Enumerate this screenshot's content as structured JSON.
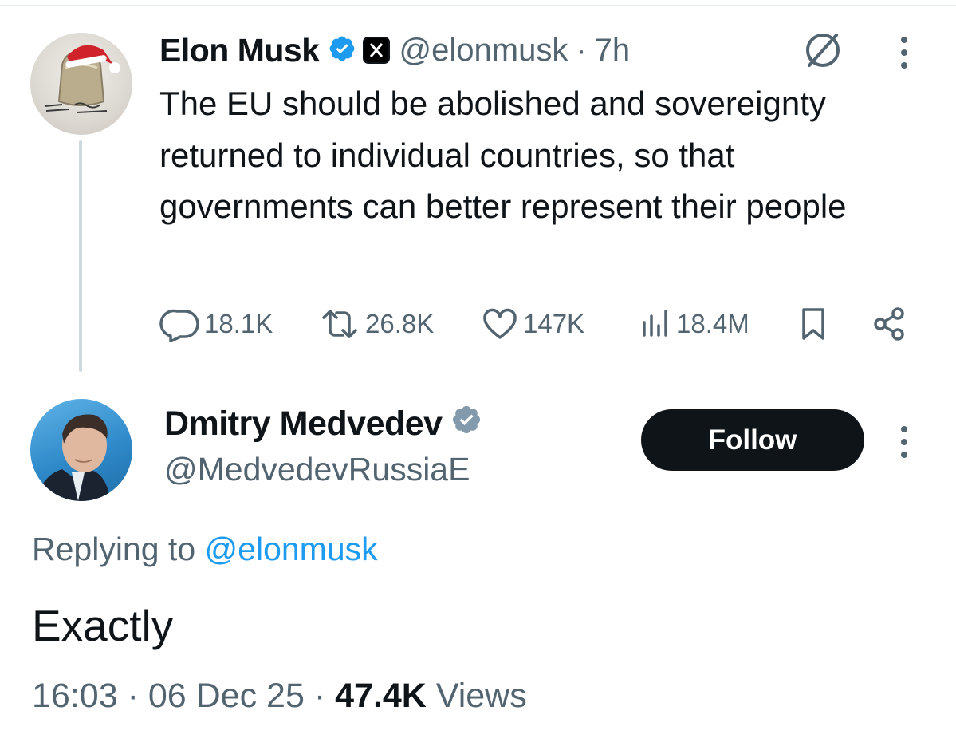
{
  "parent_tweet": {
    "author_name": "Elon Musk",
    "handle": "@elonmusk",
    "separator": "·",
    "time": "7h",
    "text": "The EU should be abolished and sovereignty returned to individual countries, so that governments can better represent their people",
    "stats": {
      "replies": "18.1K",
      "reposts": "26.8K",
      "likes": "147K",
      "views": "18.4M"
    },
    "verified_badge_color": "#1d9bf0",
    "affiliate_badge": "x-logo-badge-icon"
  },
  "reply_tweet": {
    "author_name": "Dmitry Medvedev",
    "handle": "@MedvedevRussiaE",
    "verified_badge_color": "#829aab",
    "follow_label": "Follow",
    "replying_prefix": "Replying to",
    "replying_mention": "@elonmusk",
    "text": "Exactly",
    "timestamp": "16:03",
    "sep1": "·",
    "date": "06 Dec 25",
    "sep2": "·",
    "views_count": "47.4K",
    "views_label": "Views"
  },
  "colors": {
    "text_primary": "#0f1419",
    "text_secondary": "#536471",
    "link": "#1d9bf0",
    "thread_line": "#cfd9de",
    "follow_button_bg": "#0f1419"
  }
}
